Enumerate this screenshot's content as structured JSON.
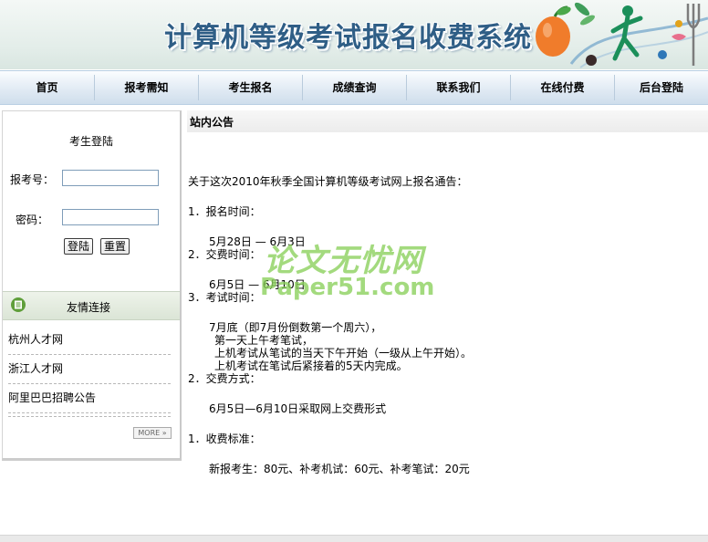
{
  "header": {
    "title": "计算机等级考试报名收费系统"
  },
  "nav": {
    "items": [
      {
        "label": "首页"
      },
      {
        "label": "报考需知"
      },
      {
        "label": "考生报名"
      },
      {
        "label": "成绩查询"
      },
      {
        "label": "联系我们"
      },
      {
        "label": "在线付费"
      },
      {
        "label": "后台登陆"
      }
    ]
  },
  "login": {
    "title": "考生登陆",
    "id_label": "报考号：",
    "password_label": "密码：",
    "id_value": "",
    "password_value": "",
    "login_button": "登陆",
    "reset_button": "重置"
  },
  "links": {
    "title": "友情连接",
    "items": [
      "杭州人才网",
      "浙江人才网",
      "阿里巴巴招聘公告"
    ],
    "more_label": "MORE »"
  },
  "notice": {
    "header": "站内公告",
    "intro": "关于这次2010年秋季全国计算机等级考试网上报名通告：",
    "sections": [
      {
        "heading": "1．报名时间：",
        "lines": [
          "5月28日 — 6月3日"
        ]
      },
      {
        "heading": "2．交费时间：",
        "lines": [
          "6月5日 — 6月10日"
        ]
      },
      {
        "heading": "3．考试时间：",
        "lines": [
          "7月底（即7月份倒数第一个周六），",
          "第一天上午考笔试，",
          "上机考试从笔试的当天下午开始（一级从上午开始）。",
          "上机考试在笔试后紧接着的5天内完成。"
        ]
      },
      {
        "heading": "2．交费方式：",
        "lines": [
          "6月5日—6月10日采取网上交费形式"
        ]
      },
      {
        "heading": "1．收费标准：",
        "lines": [
          "新报考生：80元、补考机试：60元、补考笔试：20元"
        ]
      }
    ]
  },
  "watermark": {
    "line1": "论文无忧网",
    "line2": "Paper51.com"
  },
  "colors": {
    "title_blue": "#2f5e86",
    "watermark_green": "#8ad05a",
    "nav_gradient_bottom": "#cfdeec"
  }
}
